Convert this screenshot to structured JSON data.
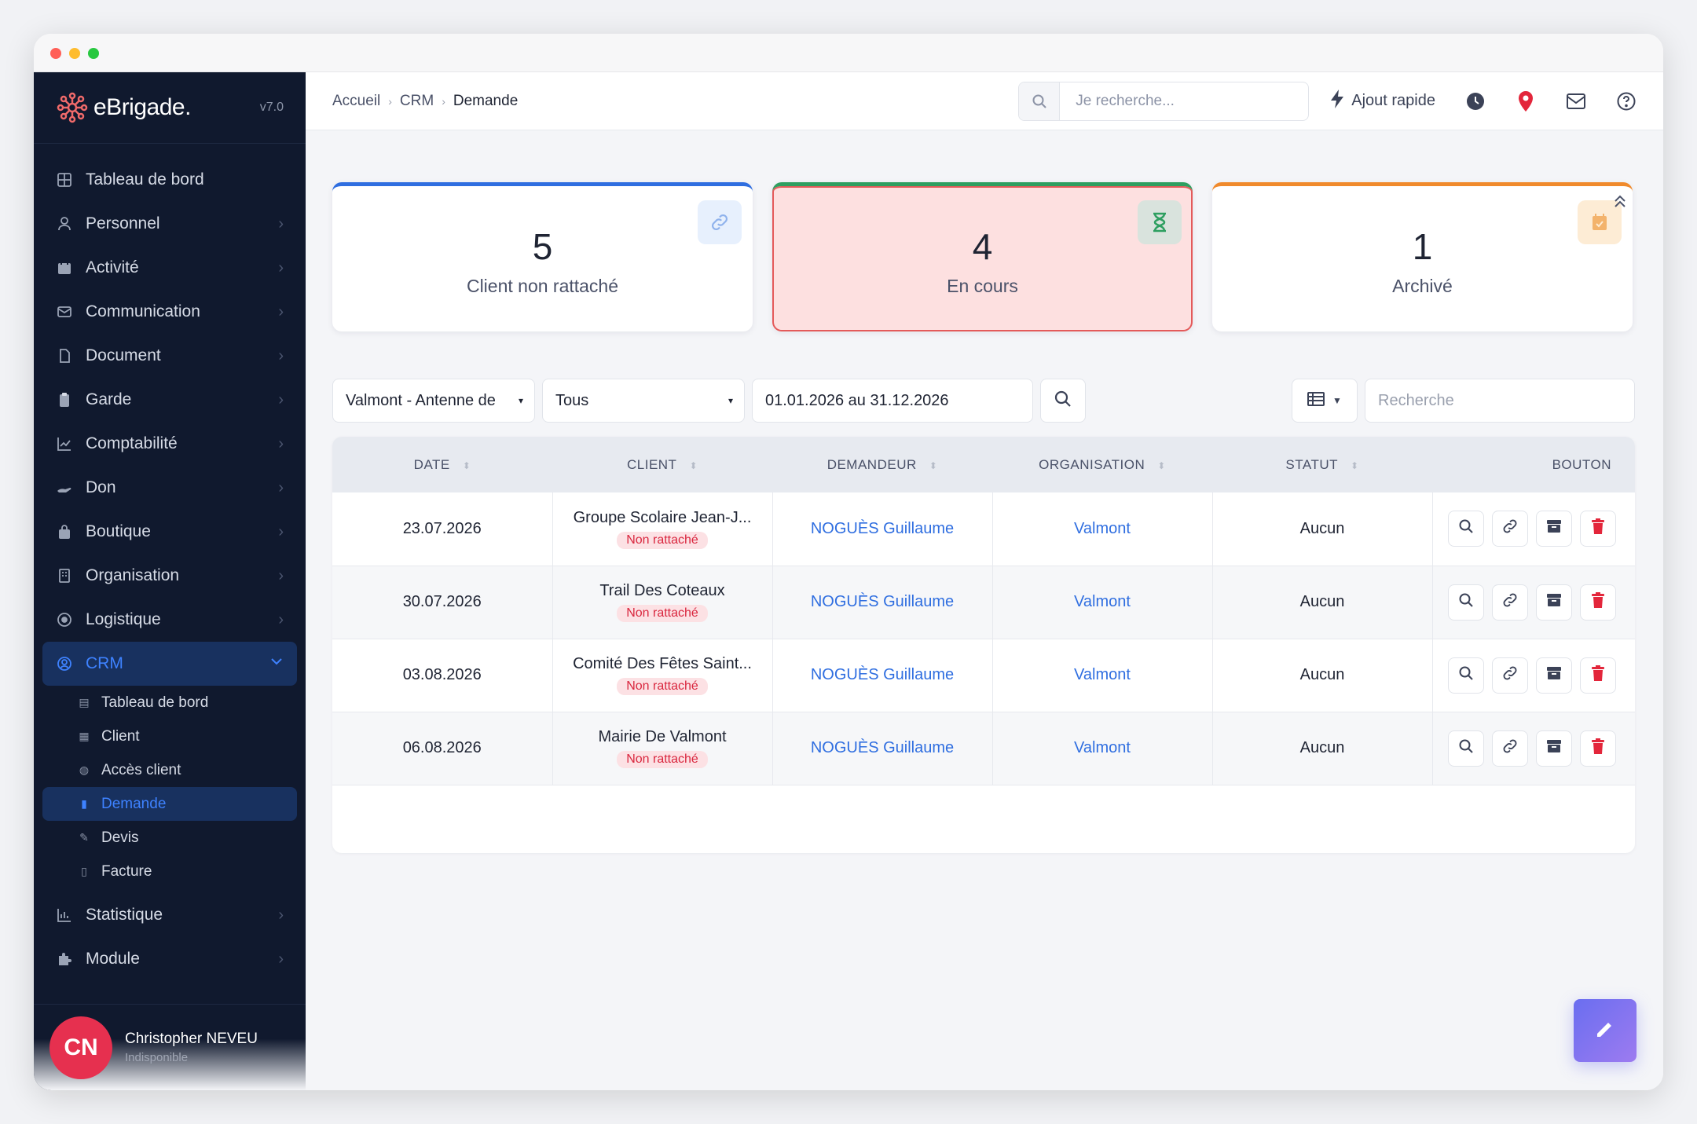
{
  "window": {
    "controls": [
      "close",
      "minimize",
      "maximize"
    ]
  },
  "brand": {
    "name": "eBrigade.",
    "version": "v7.0"
  },
  "sidebar": {
    "items": [
      {
        "label": "Tableau de bord",
        "icon": "grid-icon"
      },
      {
        "label": "Personnel",
        "icon": "user-icon"
      },
      {
        "label": "Activité",
        "icon": "calendar-icon"
      },
      {
        "label": "Communication",
        "icon": "mail-icon"
      },
      {
        "label": "Document",
        "icon": "file-icon"
      },
      {
        "label": "Garde",
        "icon": "clipboard-icon"
      },
      {
        "label": "Comptabilité",
        "icon": "chart-icon"
      },
      {
        "label": "Don",
        "icon": "hand-icon"
      },
      {
        "label": "Boutique",
        "icon": "bag-icon"
      },
      {
        "label": "Organisation",
        "icon": "building-icon"
      },
      {
        "label": "Logistique",
        "icon": "target-icon"
      },
      {
        "label": "CRM",
        "icon": "user-circle-icon"
      },
      {
        "label": "Statistique",
        "icon": "bar-chart-icon"
      },
      {
        "label": "Module",
        "icon": "puzzle-icon"
      }
    ],
    "crm_sub": [
      {
        "label": "Tableau de bord"
      },
      {
        "label": "Client"
      },
      {
        "label": "Accès client"
      },
      {
        "label": "Demande"
      },
      {
        "label": "Devis"
      },
      {
        "label": "Facture"
      }
    ]
  },
  "user": {
    "initials": "CN",
    "name": "Christopher NEVEU",
    "status": "Indisponible"
  },
  "topbar": {
    "breadcrumb": [
      "Accueil",
      "CRM",
      "Demande"
    ],
    "search_placeholder": "Je recherche...",
    "quick_add": "Ajout rapide"
  },
  "cards": [
    {
      "value": "5",
      "label": "Client non rattaché",
      "accent": "#2f6ee0"
    },
    {
      "value": "4",
      "label": "En cours",
      "accent": "#2e9f60"
    },
    {
      "value": "1",
      "label": "Archivé",
      "accent": "#f08a2c"
    }
  ],
  "filters": {
    "structure": "Valmont - Antenne de",
    "status": "Tous",
    "date_range": "01.01.2026 au 31.12.2026",
    "search_placeholder": "Recherche"
  },
  "table": {
    "columns": [
      "DATE",
      "CLIENT",
      "DEMANDEUR",
      "ORGANISATION",
      "STATUT",
      "BOUTON"
    ],
    "rows": [
      {
        "date": "23.07.2026",
        "client": "Groupe Scolaire Jean-J...",
        "badge": "Non rattaché",
        "demandeur": "NOGUÈS Guillaume",
        "organisation": "Valmont",
        "statut": "Aucun"
      },
      {
        "date": "30.07.2026",
        "client": "Trail Des Coteaux",
        "badge": "Non rattaché",
        "demandeur": "NOGUÈS Guillaume",
        "organisation": "Valmont",
        "statut": "Aucun"
      },
      {
        "date": "03.08.2026",
        "client": "Comité Des Fêtes Saint...",
        "badge": "Non rattaché",
        "demandeur": "NOGUÈS Guillaume",
        "organisation": "Valmont",
        "statut": "Aucun"
      },
      {
        "date": "06.08.2026",
        "client": "Mairie De Valmont",
        "badge": "Non rattaché",
        "demandeur": "NOGUÈS Guillaume",
        "organisation": "Valmont",
        "statut": "Aucun"
      }
    ]
  }
}
